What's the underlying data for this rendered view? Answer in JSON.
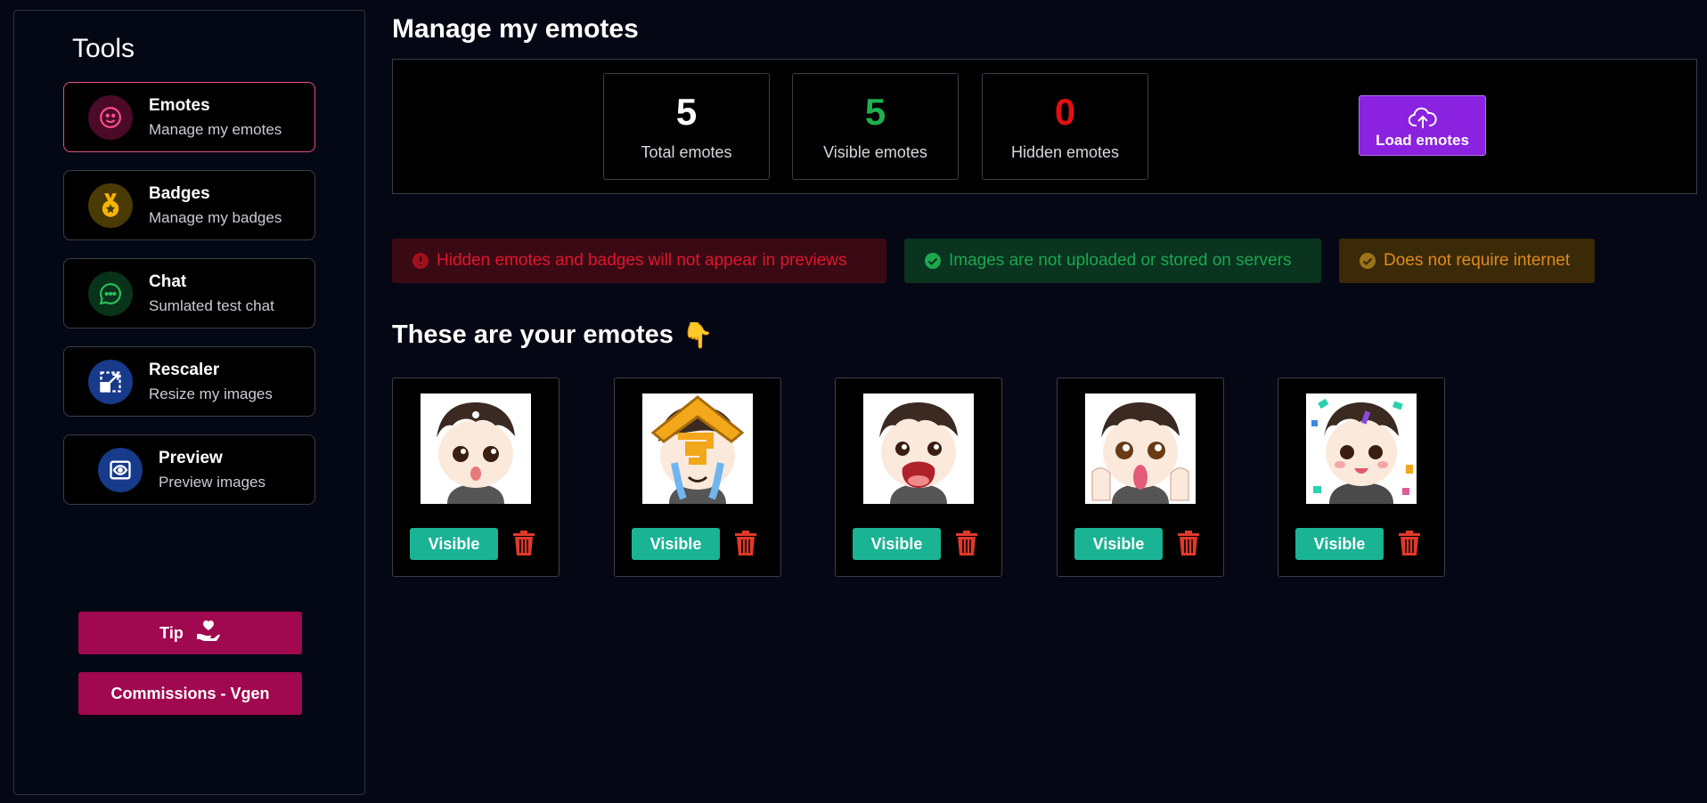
{
  "sidebar": {
    "title": "Tools",
    "items": [
      {
        "title": "Emotes",
        "subtitle": "Manage my emotes",
        "icon": "smile-icon",
        "color": "#ff4f8b"
      },
      {
        "title": "Badges",
        "subtitle": "Manage my badges",
        "icon": "medal-icon",
        "color": "#f5b400"
      },
      {
        "title": "Chat",
        "subtitle": "Sumlated test chat",
        "icon": "chat-icon",
        "color": "#2bbf5a"
      },
      {
        "title": "Rescaler",
        "subtitle": "Resize my images",
        "icon": "resize-icon",
        "color": "#2f6be0"
      },
      {
        "title": "Preview",
        "subtitle": "Preview images",
        "icon": "eye-icon",
        "color": "#2f6be0"
      }
    ],
    "tip_label": "Tip",
    "commissions_label": "Commissions - Vgen"
  },
  "main": {
    "title": "Manage my emotes",
    "stats": [
      {
        "value": "5",
        "label": "Total emotes",
        "color": "#ffffff"
      },
      {
        "value": "5",
        "label": "Visible emotes",
        "color": "#1fb04f"
      },
      {
        "value": "0",
        "label": "Hidden emotes",
        "color": "#e01010"
      }
    ],
    "load_label": "Load emotes",
    "notices": [
      {
        "text": "Hidden emotes and badges will not appear in previews",
        "color": "#e0152c",
        "bg": "#3a0a14"
      },
      {
        "text": "Images are not uploaded or stored on servers",
        "color": "#1aa84f",
        "bg": "#0a3320"
      },
      {
        "text": "Does not require internet",
        "color": "#e08a1a",
        "bg": "#3a2a08"
      }
    ],
    "section_title": "These are your emotes",
    "section_emoji": "👇",
    "emotes": [
      {
        "label": "Visible"
      },
      {
        "label": "Visible"
      },
      {
        "label": "Visible"
      },
      {
        "label": "Visible"
      },
      {
        "label": "Visible"
      }
    ]
  }
}
